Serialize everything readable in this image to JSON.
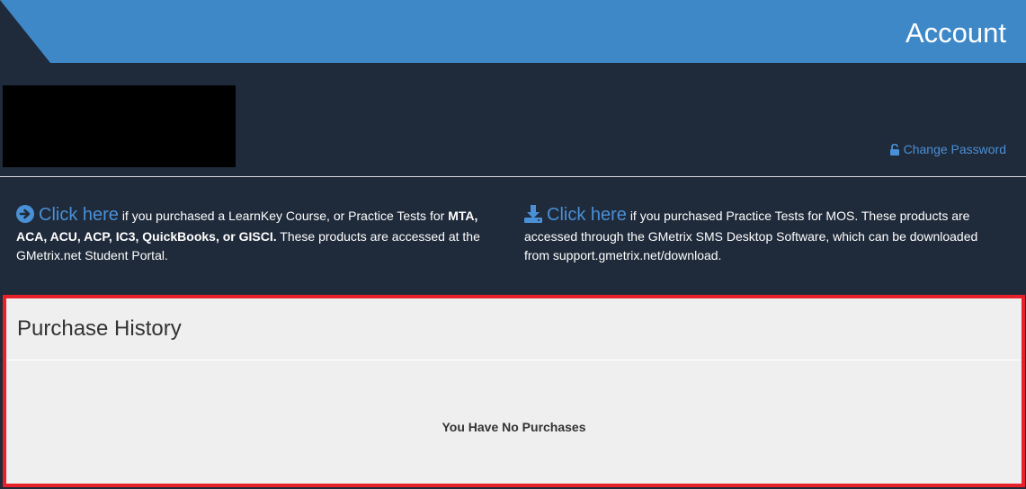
{
  "header": {
    "title": "Account"
  },
  "account": {
    "change_password": "Change Password"
  },
  "info": {
    "left": {
      "link": "Click here",
      "text_1": "if you purchased a LearnKey Course, or Practice Tests for",
      "bold": "MTA, ACA, ACU, ACP, IC3, QuickBooks, or GISCI.",
      "text_2": "These products are accessed at the GMetrix.net Student Portal."
    },
    "right": {
      "link": "Click here",
      "text": "if you purchased Practice Tests for MOS. These products are accessed through the GMetrix SMS Desktop Software, which can be downloaded from support.gmetrix.net/download."
    }
  },
  "purchase_history": {
    "title": "Purchase History",
    "empty_message": "You Have No Purchases"
  },
  "colors": {
    "background": "#1f2a3a",
    "banner": "#3f88c8",
    "link": "#4a90d6",
    "highlight_border": "#e8202a"
  }
}
